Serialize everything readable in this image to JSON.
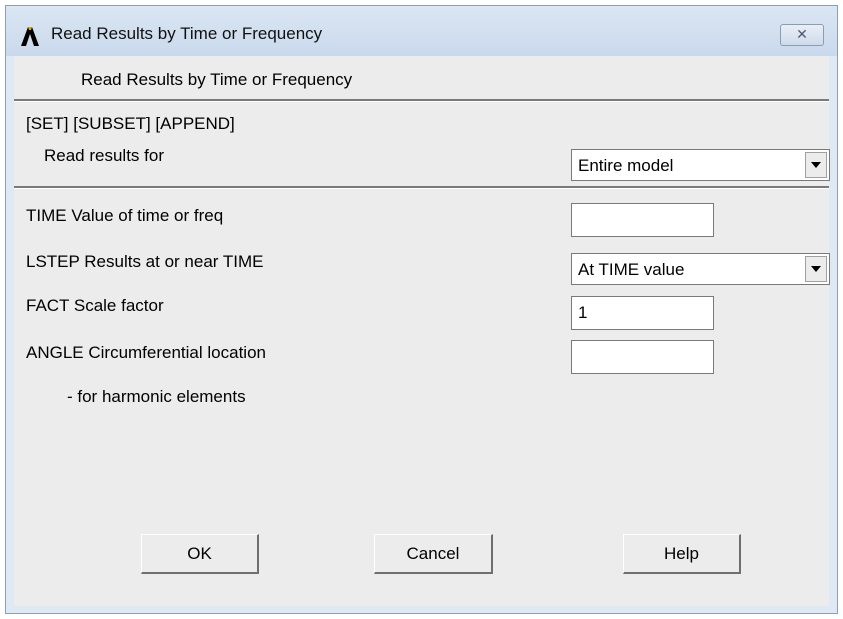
{
  "window": {
    "title": "Read Results by Time or Frequency",
    "close_icon_glyph": "✕"
  },
  "dialog": {
    "heading": "Read Results by Time or Frequency",
    "command_line": "[SET] [SUBSET] [APPEND]",
    "read_results_label": "Read results for",
    "read_results_value": "Entire model",
    "time_label": "TIME   Value of time or freq",
    "time_value": "",
    "lstep_label": "LSTEP   Results at or near TIME",
    "lstep_value": "At TIME value",
    "fact_label": "FACT   Scale factor",
    "fact_value": "1",
    "angle_label": "ANGLE   Circumferential location",
    "angle_value": "",
    "harmonic_note": "- for harmonic elements"
  },
  "buttons": {
    "ok": "OK",
    "cancel": "Cancel",
    "help": "Help"
  },
  "colors": {
    "titlebar": "#c9d9ec",
    "client": "#ececec",
    "icon": "#000000"
  }
}
